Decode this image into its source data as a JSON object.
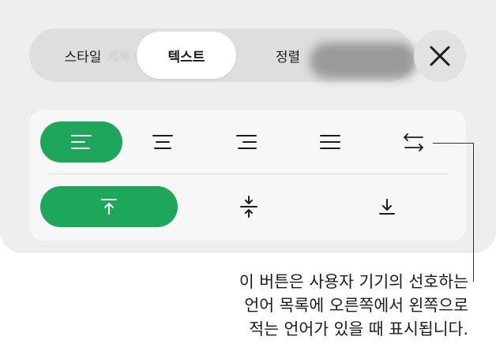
{
  "tabs": [
    {
      "label": "스타일",
      "selected": false
    },
    {
      "label": "텍스트",
      "selected": true
    },
    {
      "label": "정렬",
      "selected": false
    }
  ],
  "ghost_text": "제목 색상",
  "icons": {
    "close": "close-icon",
    "align_left": "align-left-icon",
    "align_center": "align-center-icon",
    "align_right": "align-right-icon",
    "align_justify": "align-justify-icon",
    "text_direction": "text-direction-icon",
    "valign_top": "valign-top-icon",
    "valign_middle": "valign-middle-icon",
    "valign_bottom": "valign-bottom-icon"
  },
  "selection": {
    "horizontal": "align-left",
    "vertical": "top"
  },
  "callout": {
    "lines": [
      "이 버튼은 사용자 기기의 선호하는",
      "언어 목록에 오른쪽에서 왼쪽으로",
      "적는 언어가 있을 때 표시됩니다."
    ]
  },
  "colors": {
    "accent": "#1ea65a",
    "panel": "#eeeeee",
    "tabbar": "#dedede"
  }
}
